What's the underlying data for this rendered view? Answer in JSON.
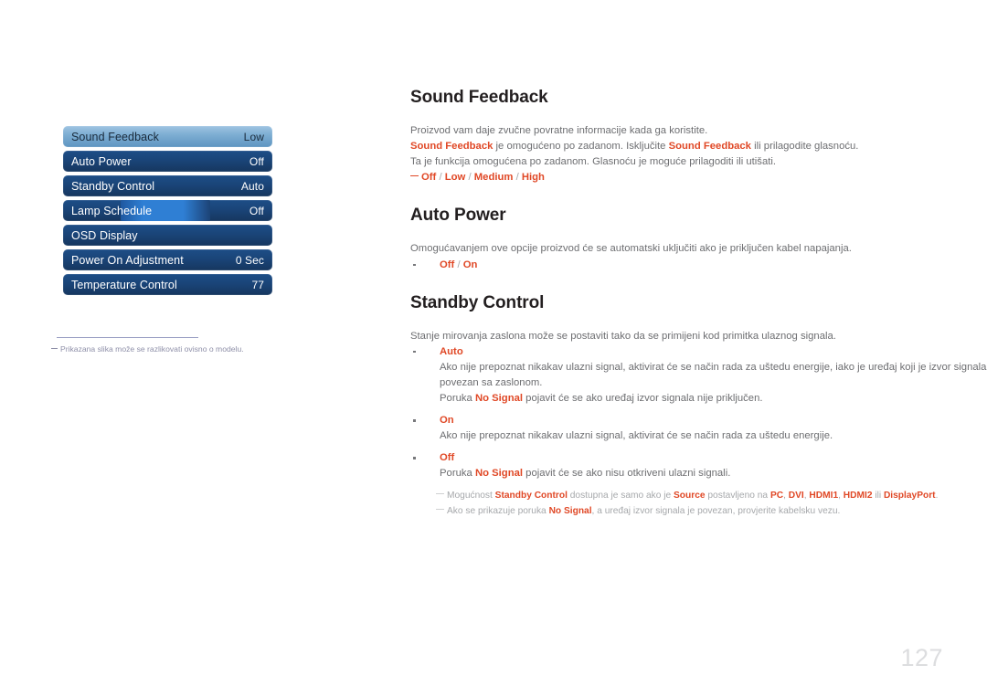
{
  "osd_menu": {
    "rows": [
      {
        "label": "Sound Feedback",
        "value": "Low",
        "state": "selected"
      },
      {
        "label": "Auto Power",
        "value": "Off",
        "state": "normal"
      },
      {
        "label": "Standby Control",
        "value": "Auto",
        "state": "normal"
      },
      {
        "label": "Lamp Schedule",
        "value": "Off",
        "state": "partial"
      },
      {
        "label": "OSD Display",
        "value": "",
        "state": "normal"
      },
      {
        "label": "Power On Adjustment",
        "value": "0 Sec",
        "state": "normal"
      },
      {
        "label": "Temperature Control",
        "value": "77",
        "state": "normal"
      }
    ],
    "footnote": "Prikazana slika može se razlikovati ovisno o modelu."
  },
  "sections": {
    "sound_feedback": {
      "title": "Sound Feedback",
      "p1": "Proizvod vam daje zvučne povratne informacije kada ga koristite.",
      "p2_a": "Sound Feedback",
      "p2_b": " je omogućeno po zadanom. Isključite ",
      "p2_c": "Sound Feedback",
      "p2_d": " ili prilagodite glasnoću.",
      "p3": "Ta je funkcija omogućena po zadanom. Glasnoću je moguće prilagoditi ili utišati.",
      "options": [
        "Off",
        "Low",
        "Medium",
        "High"
      ]
    },
    "auto_power": {
      "title": "Auto Power",
      "p1": "Omogućavanjem ove opcije proizvod će se automatski uključiti ako je priključen kabel napajanja.",
      "bullet": [
        "Off",
        "On"
      ]
    },
    "standby_control": {
      "title": "Standby Control",
      "p1": "Stanje mirovanja zaslona može se postaviti tako da se primijeni kod primitka ulaznog signala.",
      "items": [
        {
          "head": "Auto",
          "body1": "Ako nije prepoznat nikakav ulazni signal, aktivirat će se način rada za uštedu energije, iako je uređaj koji je izvor signala",
          "body2": "povezan sa zaslonom.",
          "body3_a": "Poruka ",
          "body3_b": "No Signal",
          "body3_c": " pojavit će se ako uređaj izvor signala nije priključen."
        },
        {
          "head": "On",
          "body1": "Ako nije prepoznat nikakav ulazni signal, aktivirat će se način rada za uštedu energije."
        },
        {
          "head": "Off",
          "body3_a": "Poruka ",
          "body3_b": "No Signal",
          "body3_c": " pojavit će se ako nisu otkriveni ulazni signali."
        }
      ],
      "notes": [
        {
          "a": "Mogućnost ",
          "b": "Standby Control",
          "c": " dostupna je samo ako je ",
          "d": "Source",
          "e": " postavljeno na ",
          "f": "PC",
          "g": ", ",
          "h": "DVI",
          "i": ", ",
          "j": "HDMI1",
          "k": ", ",
          "l": "HDMI2",
          "m": " ili ",
          "n": "DisplayPort",
          "o": "."
        },
        {
          "a": "Ako se prikazuje poruka ",
          "b": "No Signal",
          "c": ", a uređaj izvor signala je povezan, provjerite kabelsku vezu."
        }
      ]
    }
  },
  "page_number": "127",
  "colors": {
    "accent_red": "#e04826",
    "heading": "#231f20",
    "body_text": "#6d6e71",
    "osd_blue": "#1a4478",
    "osd_selected": "#7eaed3"
  }
}
